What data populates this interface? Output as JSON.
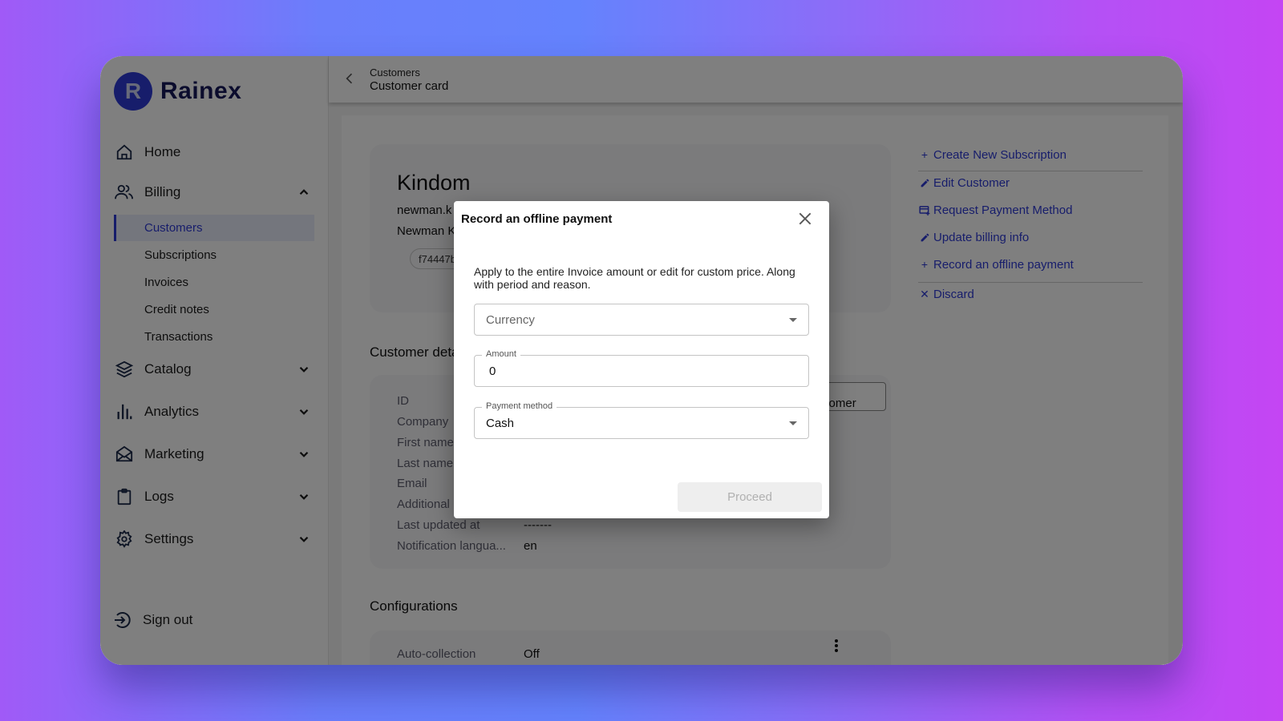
{
  "app": {
    "brand": "Rainex",
    "brand_initial": "R",
    "accent_color": "#2e3bd6"
  },
  "breadcrumb": {
    "parent": "Customers",
    "current": "Customer card"
  },
  "sidebar": {
    "items": [
      {
        "label": "Home",
        "icon": "home-icon"
      },
      {
        "label": "Billing",
        "icon": "users-icon",
        "expanded": true,
        "children": [
          {
            "label": "Customers",
            "active": true
          },
          {
            "label": "Subscriptions"
          },
          {
            "label": "Invoices"
          },
          {
            "label": "Credit notes"
          },
          {
            "label": "Transactions"
          }
        ]
      },
      {
        "label": "Catalog",
        "icon": "layers-icon",
        "expanded": false
      },
      {
        "label": "Analytics",
        "icon": "bar-chart-icon",
        "expanded": false
      },
      {
        "label": "Marketing",
        "icon": "mail-open-icon",
        "expanded": false
      },
      {
        "label": "Logs",
        "icon": "clipboard-icon",
        "expanded": false
      },
      {
        "label": "Settings",
        "icon": "gear-icon",
        "expanded": false
      }
    ],
    "sign_out": "Sign out"
  },
  "customer": {
    "name": "Kindom",
    "email": "newman.k",
    "contact": "Newman K",
    "id_chip": "f74447b"
  },
  "details": {
    "title": "Customer details",
    "labels": [
      "ID",
      "Company",
      "First name",
      "Last name",
      "Email",
      "Additional",
      "Last updated at",
      "Notification langua..."
    ],
    "last_updated_value": "-------",
    "notification_language_value": "en",
    "edit_button": "Edit customer"
  },
  "configurations": {
    "title": "Configurations",
    "rows": [
      {
        "label": "Auto-collection",
        "value": "Off"
      }
    ]
  },
  "actions": [
    {
      "label": "Create New Subscription",
      "icon": "plus-icon"
    },
    {
      "label": "Edit Customer",
      "icon": "pencil-icon"
    },
    {
      "label": "Request Payment Method",
      "icon": "card-plus-icon"
    },
    {
      "label": "Update billing info",
      "icon": "pencil-icon"
    },
    {
      "label": "Record an offline payment",
      "icon": "plus-icon"
    },
    {
      "label": "Discard",
      "icon": "close-icon"
    }
  ],
  "modal": {
    "title": "Record an offline payment",
    "description": "Apply to the entire Invoice amount or edit for custom price. Along with period and reason.",
    "currency_placeholder": "Currency",
    "amount_label": "Amount",
    "amount_value": "0",
    "payment_method_label": "Payment method",
    "payment_method_value": "Cash",
    "proceed_label": "Proceed"
  }
}
